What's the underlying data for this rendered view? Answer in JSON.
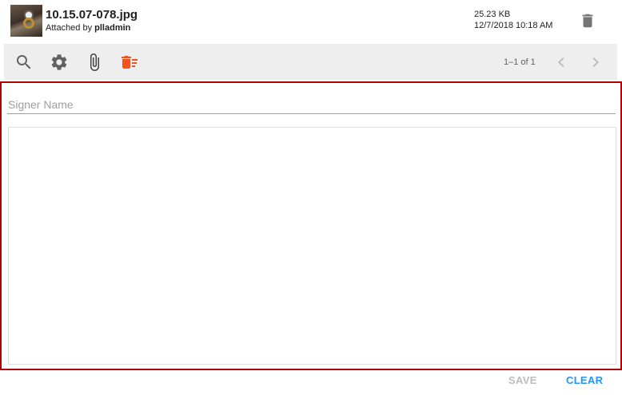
{
  "attachment": {
    "file_name": "10.15.07-078.jpg",
    "attached_by_prefix": "Attached by ",
    "attached_by_user": "plladmin",
    "size": "25.23 KB",
    "date": "12/7/2018 10:18 AM"
  },
  "toolbar": {
    "icons": [
      "search-icon",
      "gear-icon",
      "paperclip-icon",
      "delete-sweep-icon"
    ],
    "pagination": "1–1 of 1"
  },
  "signature": {
    "signer_placeholder": "Signer Name",
    "signer_value": ""
  },
  "actions": {
    "save_label": "SAVE",
    "clear_label": "CLEAR"
  },
  "colors": {
    "accent": "#2196f3",
    "panel_border": "#b00000",
    "delete_sweep": "#f4511e",
    "toolbar_bg": "#eeeeee"
  }
}
